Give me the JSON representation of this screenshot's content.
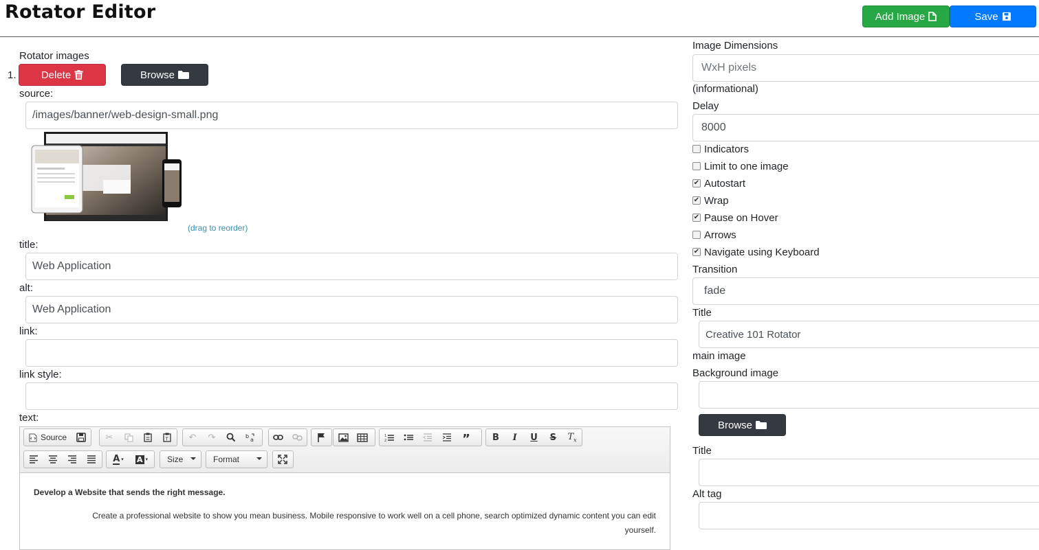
{
  "header": {
    "title": "Rotator Editor",
    "add_image_label": "Add Image",
    "save_label": "Save"
  },
  "left": {
    "section_label": "Rotator images",
    "item_number": "1.",
    "delete_label": "Delete",
    "browse_label": "Browse",
    "source_label": "source:",
    "source_value": "/images/banner/web-design-small.png",
    "drag_hint": "(drag to reorder)",
    "title_label": "title:",
    "title_value": "Web Application",
    "alt_label": "alt:",
    "alt_value": "Web Application",
    "link_label": "link:",
    "link_value": "",
    "link_style_label": "link style:",
    "link_style_value": "",
    "text_label": "text:"
  },
  "editor": {
    "source_label": "Source",
    "size_label": "Size",
    "format_label": "Format",
    "heading": "Develop a Website that sends the right message.",
    "paragraph_line1": "Create a professional website to show you mean business. Mobile responsive to work well on a cell phone, search optimized dynamic content you can edit",
    "paragraph_line2": "yourself."
  },
  "right": {
    "dimensions_label": "Image Dimensions",
    "dimensions_placeholder": "WxH pixels",
    "dimensions_note": "(informational)",
    "delay_label": "Delay",
    "delay_value": "8000",
    "options": [
      {
        "label": "Indicators",
        "checked": false
      },
      {
        "label": "Limit to one image",
        "checked": false
      },
      {
        "label": "Autostart",
        "checked": true
      },
      {
        "label": "Wrap",
        "checked": true
      },
      {
        "label": "Pause on Hover",
        "checked": true
      },
      {
        "label": "Arrows",
        "checked": false
      },
      {
        "label": "Navigate using Keyboard",
        "checked": true
      }
    ],
    "check_mark": "✔",
    "transition_label": "Transition",
    "transition_value": "fade",
    "title_label": "Title",
    "title_value": "Creative 101 Rotator",
    "main_image_label": "main image",
    "background_label": "Background image",
    "background_value": "",
    "browse_label": "Browse",
    "bg_title_label": "Title",
    "bg_title_value": "",
    "alt_tag_label": "Alt tag",
    "alt_tag_value": ""
  },
  "colors": {
    "green": "#28a745",
    "blue": "#007bff",
    "red": "#dc3545",
    "dark": "#343a40"
  }
}
